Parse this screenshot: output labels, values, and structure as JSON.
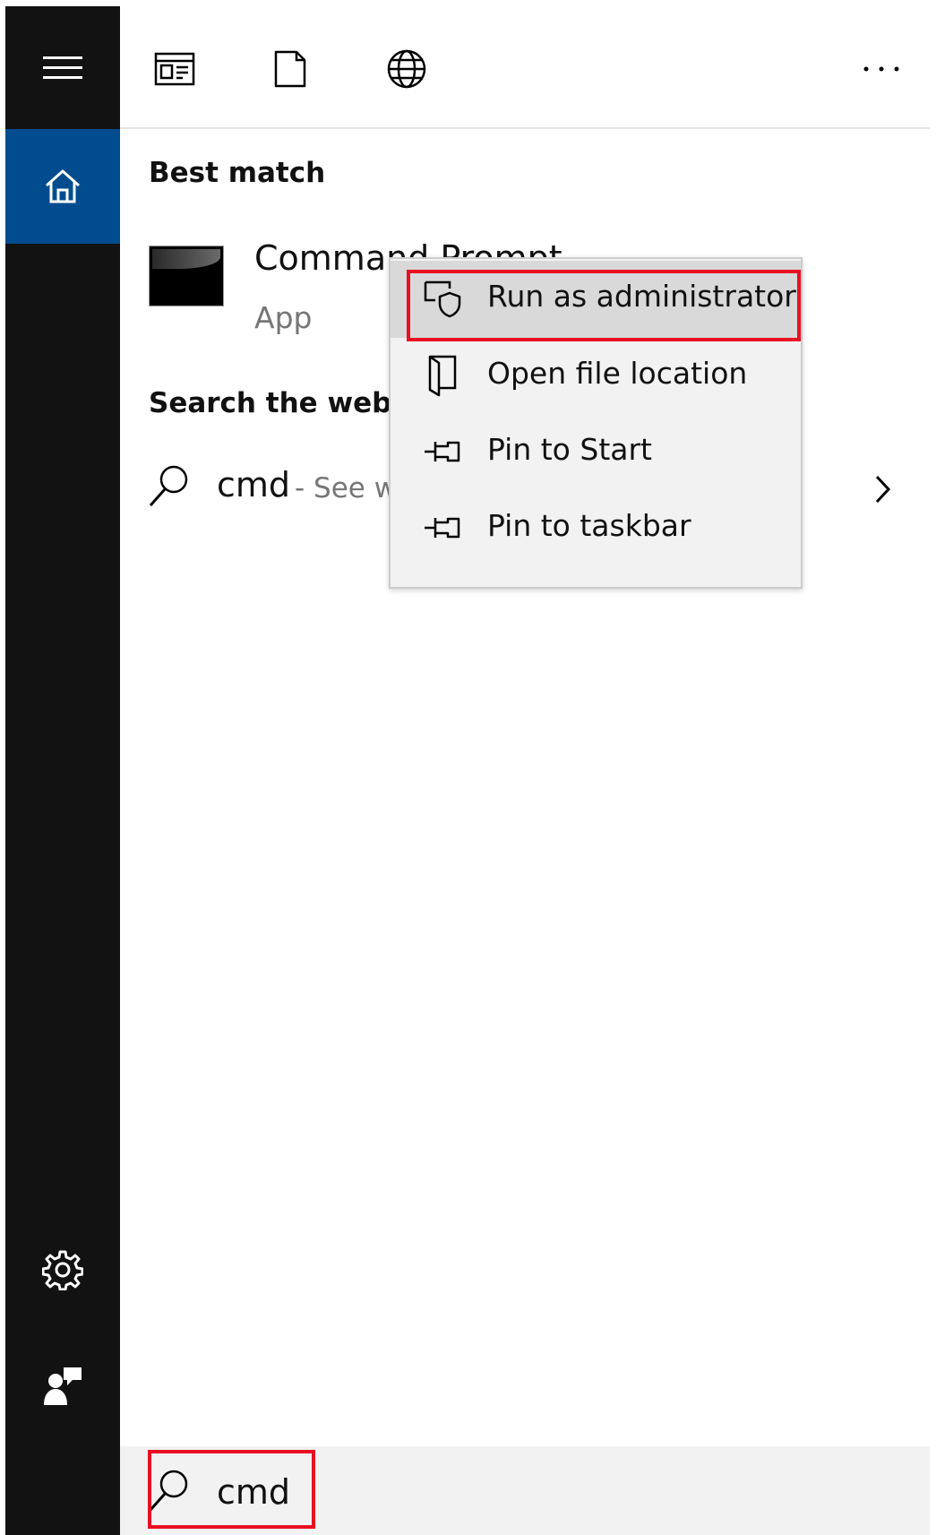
{
  "sidebar": {
    "menu_icon": "hamburger-icon",
    "home_icon": "home-icon",
    "settings_icon": "gear-icon",
    "feedback_icon": "feedback-icon",
    "home_color": "#004c8e"
  },
  "topbar": {
    "icons": [
      "apps-icon",
      "documents-icon",
      "web-icon",
      "more-icon"
    ]
  },
  "best_match": {
    "title": "Best match",
    "app_name": "Command Prompt",
    "app_type": "App"
  },
  "search_web": {
    "title": "Search the web",
    "query": "cmd",
    "hint": "- See w"
  },
  "context_menu": {
    "items": [
      {
        "label": "Run as administrator",
        "icon": "shield-admin-icon"
      },
      {
        "label": "Open file location",
        "icon": "folder-location-icon"
      },
      {
        "label": "Pin to Start",
        "icon": "pin-icon"
      },
      {
        "label": "Pin to taskbar",
        "icon": "pin-icon"
      }
    ]
  },
  "search": {
    "value": "cmd"
  },
  "colors": {
    "highlight": "#e81123",
    "sidebar_bg": "#121212"
  }
}
